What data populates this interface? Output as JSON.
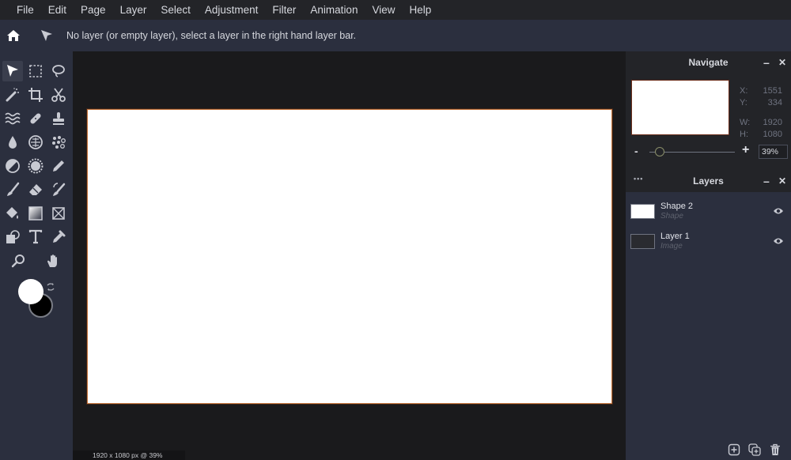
{
  "menu": [
    "File",
    "Edit",
    "Page",
    "Layer",
    "Select",
    "Adjustment",
    "Filter",
    "Animation",
    "View",
    "Help"
  ],
  "toolbar": {
    "home_icon": "home-icon",
    "pointer_icon": "pointer-icon",
    "message": "No layer (or empty layer), select a layer in the right hand layer bar."
  },
  "tools": [
    "select",
    "rect-select",
    "lasso",
    "magic-wand",
    "crop",
    "cut",
    "liquify",
    "heal",
    "clone",
    "blur",
    "sponge",
    "pixelate",
    "dodge-burn",
    "bloat",
    "pen",
    "brush",
    "eraser",
    "color-replace",
    "fill",
    "gradient",
    "shape-crop",
    "shape",
    "text",
    "color-picker",
    "zoom",
    "hand"
  ],
  "colors": {
    "foreground": "#ffffff",
    "background": "#000000",
    "accent": "#c4743c"
  },
  "status": "1920 x 1080 px @ 39%",
  "navigate": {
    "title": "Navigate",
    "x_label": "X:",
    "x_value": "1551",
    "y_label": "Y:",
    "y_value": "334",
    "w_label": "W:",
    "w_value": "1920",
    "h_label": "H:",
    "h_value": "1080",
    "zoom_minus": "-",
    "zoom_plus": "+",
    "zoom_value": "39%",
    "zoom_slider_fraction": 0.12
  },
  "layers": {
    "title": "Layers",
    "more": "•••",
    "items": [
      {
        "name": "Shape 2",
        "type": "Shape",
        "thumb": "white"
      },
      {
        "name": "Layer 1",
        "type": "Image",
        "thumb": "transparent"
      }
    ]
  },
  "panel_controls": {
    "minimize": "–",
    "close": "✕"
  }
}
